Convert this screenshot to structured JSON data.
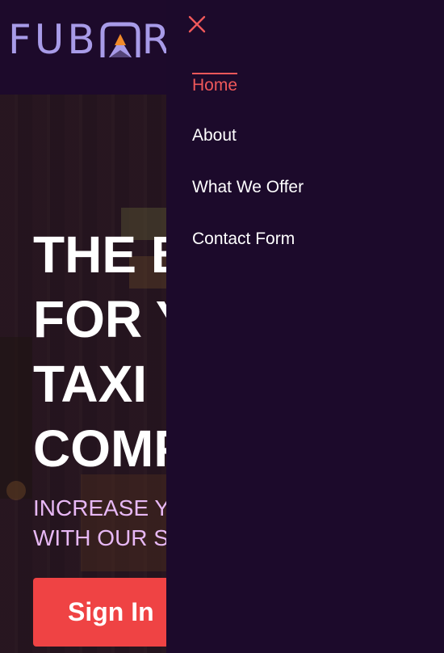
{
  "brand": {
    "logo_text_left": "FUB",
    "logo_text_right": "R",
    "accent": "#ef4344",
    "logo_color": "#a89be8"
  },
  "hero": {
    "title": "THE B\nFOR Y\nTAXI\nCOMP",
    "subtitle": "INCREASE YO\nWITH OUR SI",
    "cta_label": "Sign In"
  },
  "drawer": {
    "close_icon": "close-icon",
    "items": [
      {
        "label": "Home",
        "active": true
      },
      {
        "label": "About",
        "active": false
      },
      {
        "label": "What We Offer",
        "active": false
      },
      {
        "label": "Contact Form",
        "active": false
      }
    ]
  }
}
